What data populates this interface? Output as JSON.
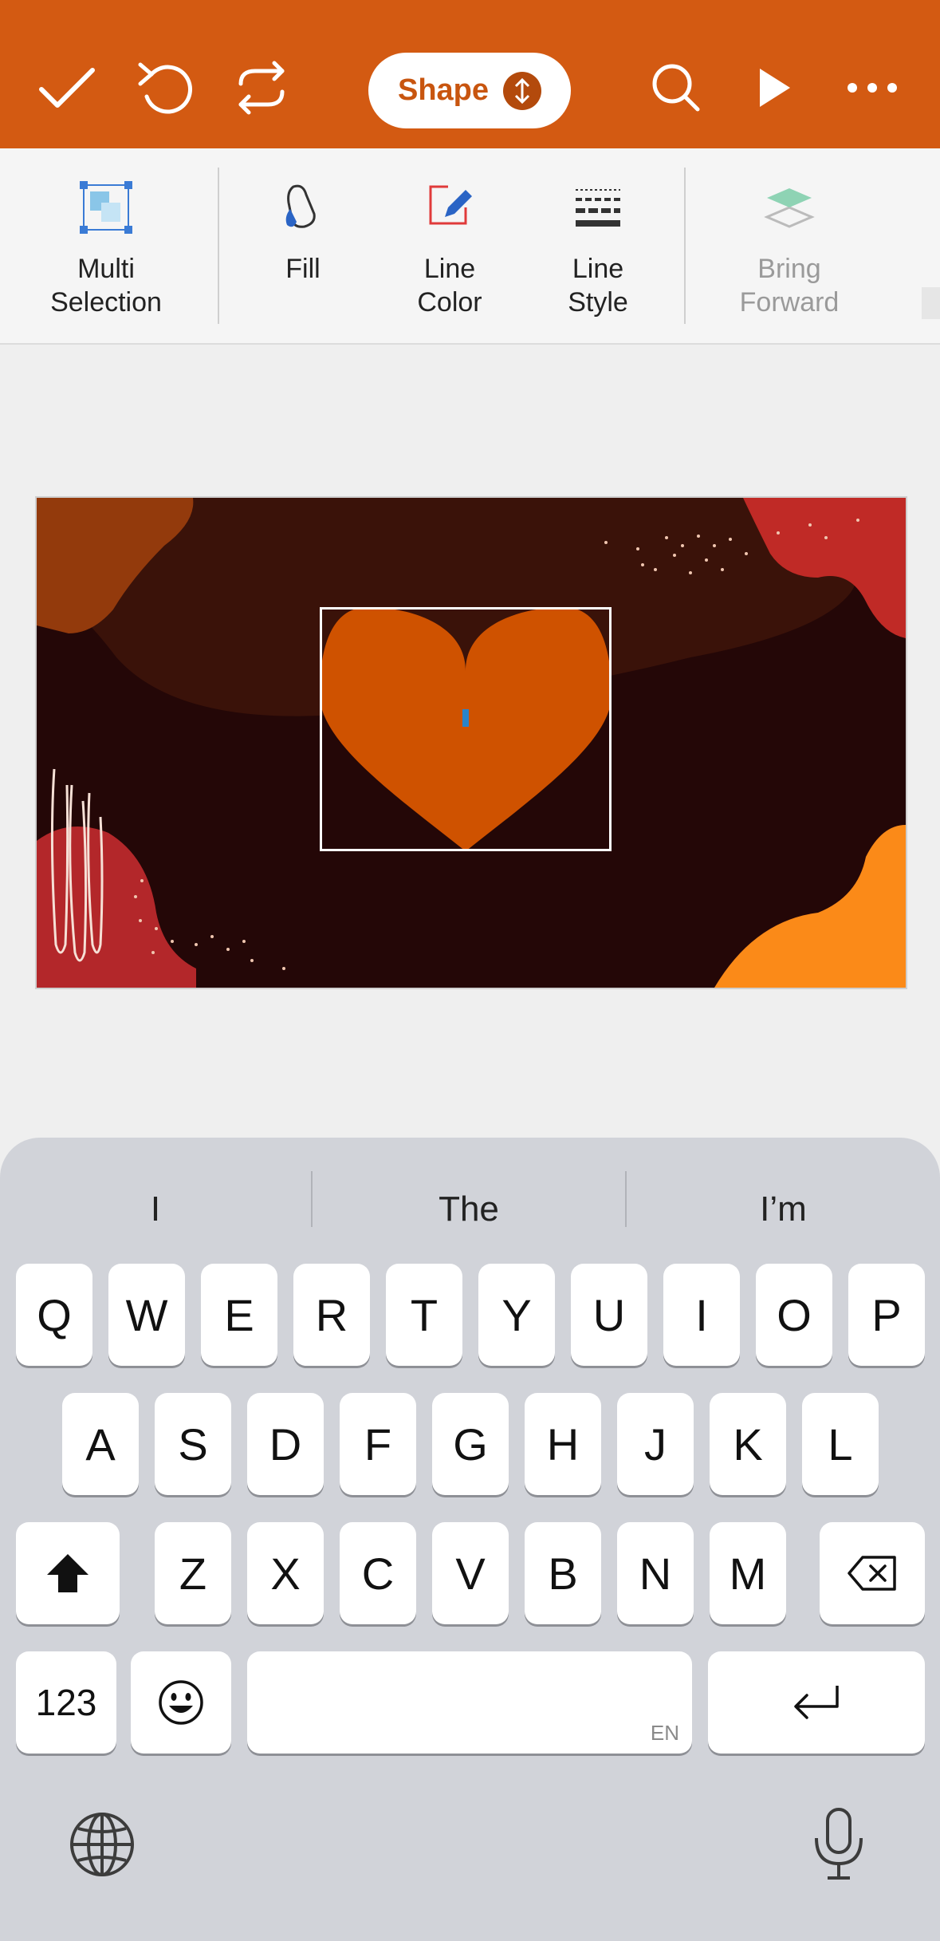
{
  "toolbar": {
    "mode_label": "Shape",
    "icons": [
      "checkmark-icon",
      "undo-icon",
      "redo-icon",
      "search-icon",
      "play-icon",
      "more-icon"
    ],
    "accent_color": "#d35a12"
  },
  "ribbon": {
    "items": [
      {
        "label": "Multi\nSelection",
        "icon": "multi-selection-icon",
        "enabled": true
      },
      {
        "label": "Fill",
        "icon": "fill-bucket-icon",
        "enabled": true
      },
      {
        "label": "Line\nColor",
        "icon": "line-color-icon",
        "enabled": true
      },
      {
        "label": "Line\nStyle",
        "icon": "line-style-icon",
        "enabled": true
      },
      {
        "label": "Bring\nForward",
        "icon": "bring-forward-icon",
        "enabled": false
      }
    ]
  },
  "slide": {
    "background": "#260707",
    "selected_shape": "heart",
    "shape_color": "#cf5200"
  },
  "keyboard": {
    "suggestions": [
      "I",
      "The",
      "I’m"
    ],
    "row1": [
      "Q",
      "W",
      "E",
      "R",
      "T",
      "Y",
      "U",
      "I",
      "O",
      "P"
    ],
    "row2": [
      "A",
      "S",
      "D",
      "F",
      "G",
      "H",
      "J",
      "K",
      "L"
    ],
    "row3": [
      "Z",
      "X",
      "C",
      "V",
      "B",
      "N",
      "M"
    ],
    "numbers_label": "123",
    "space_lang": "EN"
  }
}
